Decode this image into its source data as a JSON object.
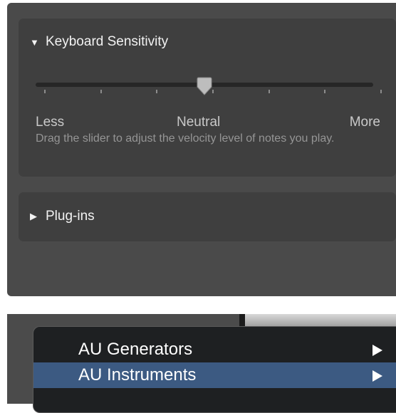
{
  "keyboard_sensitivity": {
    "title": "Keyboard Sensitivity",
    "expanded": true,
    "slider": {
      "value": 0.5,
      "ticks": 7,
      "labels": {
        "min": "Less",
        "mid": "Neutral",
        "max": "More"
      }
    },
    "description": "Drag the slider to adjust the velocity level of notes you play."
  },
  "plugins": {
    "title": "Plug-ins",
    "expanded": false
  },
  "menu": {
    "items": [
      {
        "label": "AU Generators",
        "selected": false,
        "has_submenu": true
      },
      {
        "label": "AU Instruments",
        "selected": true,
        "has_submenu": true
      }
    ]
  },
  "icons": {
    "expanded": "triangle-down-icon",
    "collapsed": "triangle-right-icon",
    "submenu": "submenu-arrow-icon"
  },
  "colors": {
    "panel": "#4a4a4a",
    "section": "#3f3f3f",
    "menu_background": "#1e2022",
    "menu_highlight": "#3c5a82"
  }
}
